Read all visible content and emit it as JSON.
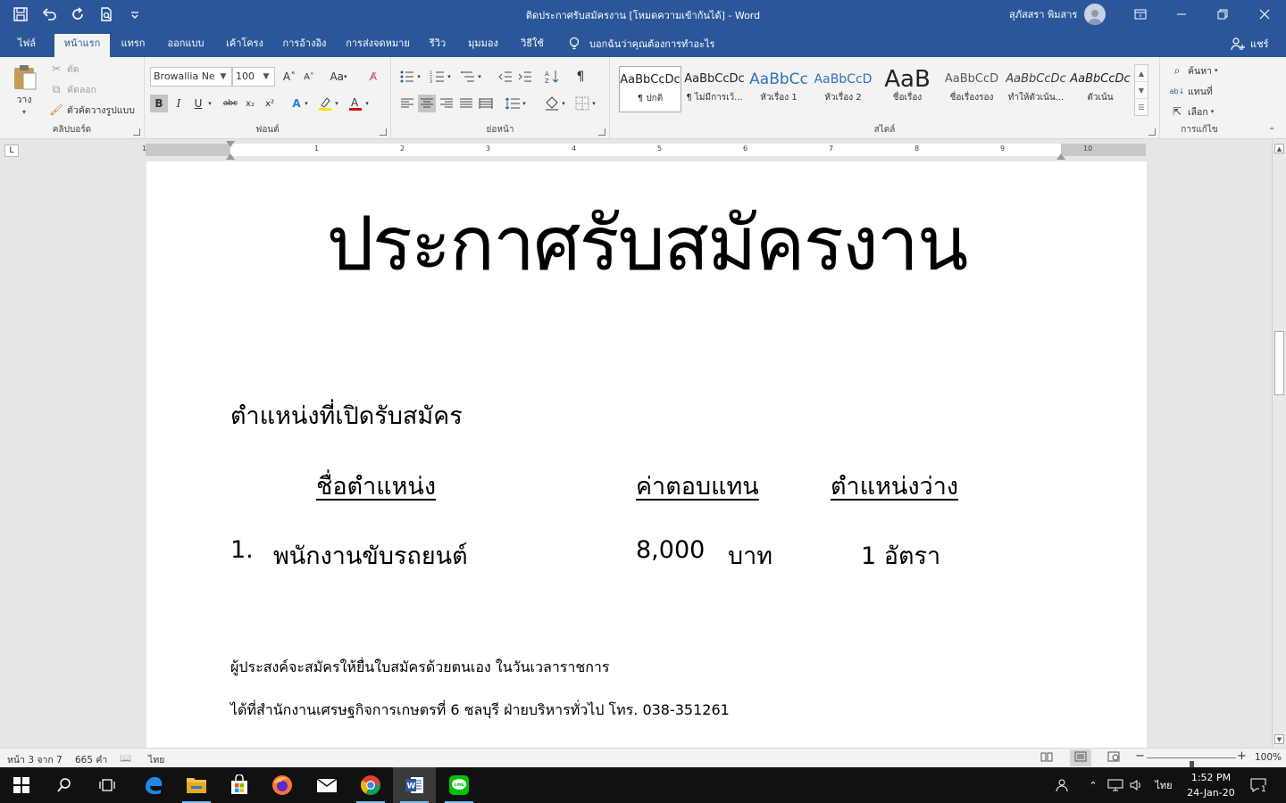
{
  "window": {
    "title": "ติดประกาศรับสมัครงาน [โหมดความเข้ากันได้] - Word",
    "user_name": "สุภัสสรา พิมสาร",
    "accent": "#2b579a"
  },
  "tabs": [
    {
      "label": "ไฟล์"
    },
    {
      "label": "หน้าแรก"
    },
    {
      "label": "แทรก"
    },
    {
      "label": "ออกแบบ"
    },
    {
      "label": "เค้าโครง"
    },
    {
      "label": "การอ้างอิง"
    },
    {
      "label": "การส่งจดหมาย"
    },
    {
      "label": "รีวิว"
    },
    {
      "label": "มุมมอง"
    },
    {
      "label": "วิธีใช้"
    }
  ],
  "tell_me": "บอกฉันว่าคุณต้องการทำอะไร",
  "share_label": "แชร์",
  "ribbon": {
    "clipboard": {
      "label": "คลิปบอร์ด",
      "paste": "วาง",
      "cut": "ตัด",
      "copy": "คัดลอก",
      "format_painter": "ตัวคัดวางรูปแบบ"
    },
    "font": {
      "label": "ฟอนต์",
      "font_name": "Browallia Ne",
      "font_size": "100",
      "change_case": "Aa",
      "bold": "B",
      "italic": "I",
      "underline": "U",
      "strike": "abc",
      "subscript": "x₂",
      "superscript": "x²"
    },
    "paragraph": {
      "label": "ย่อหน้า"
    },
    "styles": {
      "label": "สไตล์",
      "items": [
        {
          "sample": "AaBbCcDc",
          "name": "¶ ปกติ"
        },
        {
          "sample": "AaBbCcDc",
          "name": "¶ ไม่มีการเว้..."
        },
        {
          "sample": "AaBbCc",
          "name": "หัวเรื่อง 1"
        },
        {
          "sample": "AaBbCcD",
          "name": "หัวเรื่อง 2"
        },
        {
          "sample": "AaB",
          "name": "ชื่อเรื่อง"
        },
        {
          "sample": "AaBbCcD",
          "name": "ชื่อเรื่องรอง"
        },
        {
          "sample": "AaBbCcDc",
          "name": "ทำให้ตัวเน้น..."
        },
        {
          "sample": "AaBbCcDc",
          "name": "ตัวเน้น"
        }
      ]
    },
    "editing": {
      "label": "การแก้ไข",
      "find": "ค้นหา",
      "replace": "แทนที่",
      "select": "เลือก"
    }
  },
  "ruler": {
    "numbers": [
      "1",
      "1",
      "2",
      "3",
      "4",
      "5",
      "6",
      "7",
      "8",
      "9",
      "10"
    ],
    "corner": "L"
  },
  "document": {
    "heading": "ประกาศรับสมัครงาน",
    "section_title": "ตำแหน่งที่เปิดรับสมัคร",
    "columns": [
      "ชื่อตำแหน่ง",
      "ค่าตอบแทน",
      "ตำแหน่งว่าง"
    ],
    "rows": [
      {
        "number": "1.",
        "position": "พนักงานขับรถยนต์",
        "pay": "8,000",
        "currency": "บาท",
        "vacancy": "1 อัตรา"
      }
    ],
    "paragraphs": [
      "ผู้ประสงค์จะสมัครให้ยื่นใบสมัครด้วยตนเอง ในวันเวลาราชการ",
      "ได้ที่สำนักงานเศรษฐกิจการเกษตรที่ 6 ชลบุรี ฝ่ายบริหารทั่วไป  โทร. 038-351261"
    ]
  },
  "statusbar": {
    "page": "หน้า 3 จาก 7",
    "words": "665 คำ",
    "language": "ไทย",
    "zoom": "100%",
    "zoom_level": 0.5
  },
  "taskbar": {
    "apps": [
      {
        "icon": "edge-icon"
      },
      {
        "icon": "file-explorer-icon"
      },
      {
        "icon": "store-icon"
      },
      {
        "icon": "firefox-icon"
      },
      {
        "icon": "mail-icon"
      },
      {
        "icon": "chrome-icon"
      },
      {
        "icon": "word-icon"
      },
      {
        "icon": "line-icon"
      }
    ],
    "ime": "ไทย",
    "time": "1:52 PM",
    "date": "24-Jan-20",
    "notification_count": "1"
  }
}
